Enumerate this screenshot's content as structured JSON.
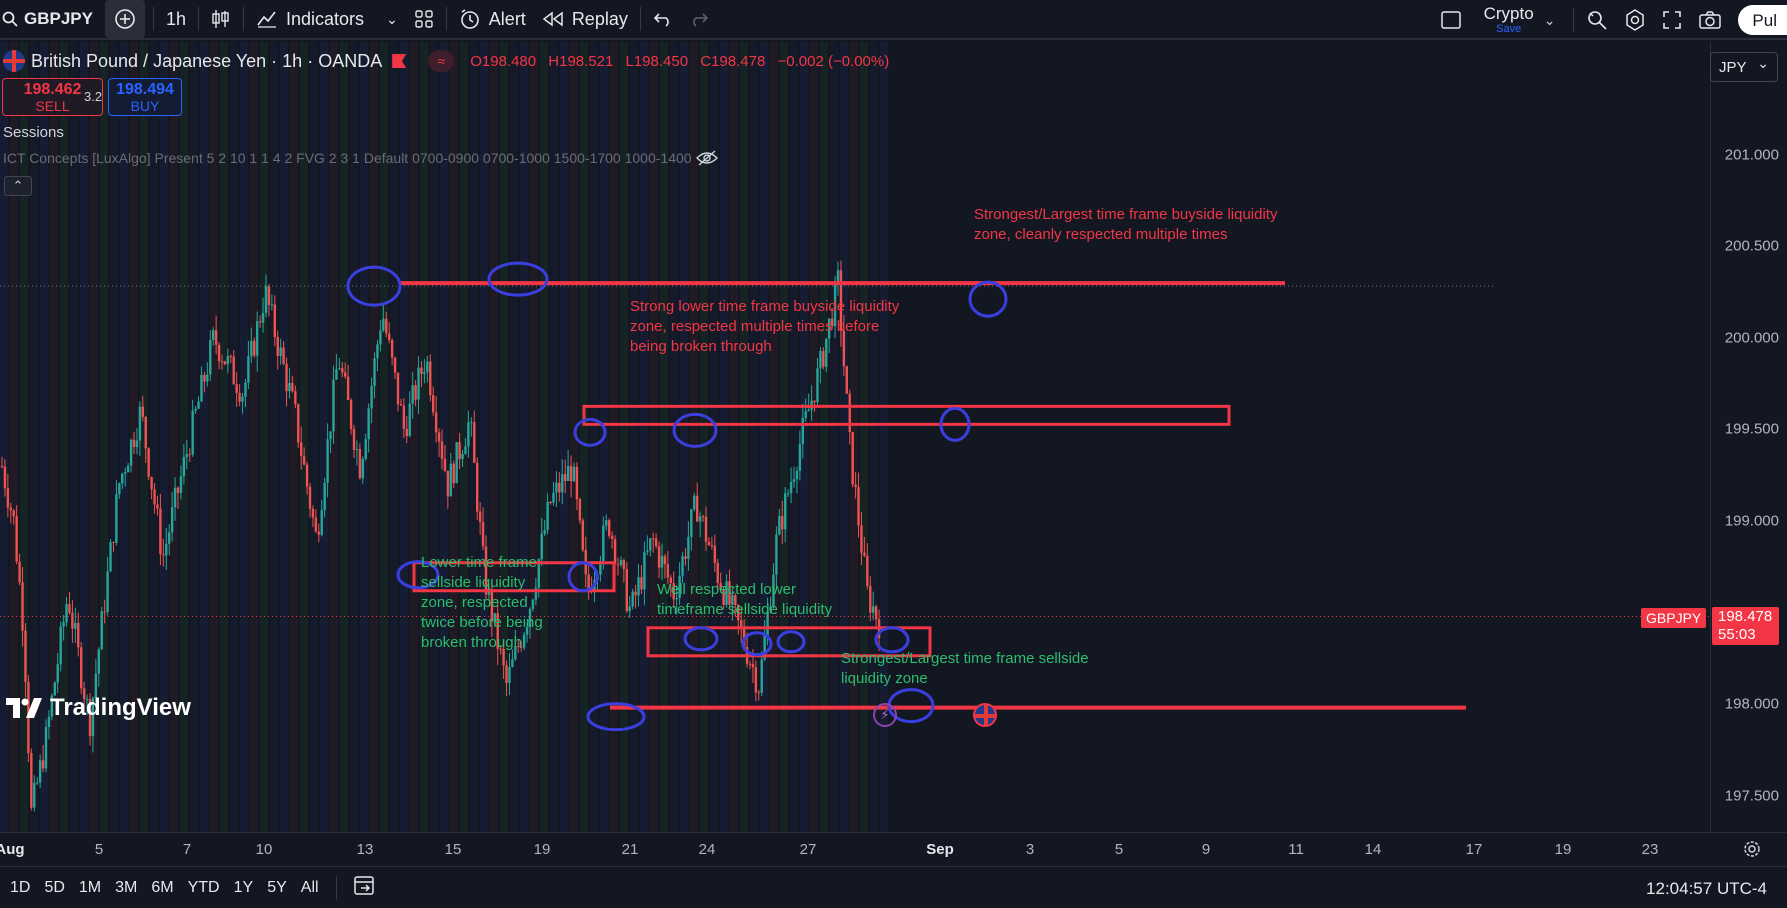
{
  "topbar": {
    "symbol": "GBPJPY",
    "interval": "1h",
    "indicators_label": "Indicators",
    "alert_label": "Alert",
    "replay_label": "Replay",
    "layout_name": "Crypto",
    "layout_save": "Save",
    "publish_label": "Pul"
  },
  "legend": {
    "title": "British Pound / Japanese Yen · 1h · OANDA",
    "open": "O198.480",
    "high": "H198.521",
    "low": "L198.450",
    "close": "C198.478",
    "change": "−0.002 (−0.00%)",
    "indicator_badge": "≈"
  },
  "trade": {
    "sell_price": "198.462",
    "sell_label": "SELL",
    "spread": "3.2",
    "buy_price": "198.494",
    "buy_label": "BUY"
  },
  "indicators": {
    "sessions": "Sessions",
    "ict": "ICT Concepts [LuxAlgo] Present 5 2 10 1 1 4 2 FVG 2 3 1 Default 0700-0900 0700-1000 1500-1700 1000-1400",
    "collapse": "⌃"
  },
  "price_scale": {
    "currency": "JPY",
    "ticks": [
      "201.000",
      "200.500",
      "200.000",
      "199.500",
      "199.000",
      "198.000",
      "197.500"
    ],
    "symbol_tag": "GBPJPY",
    "last_price": "198.478",
    "countdown": "55:03"
  },
  "time_axis": [
    {
      "label": "Aug",
      "bold": true
    },
    {
      "label": "5"
    },
    {
      "label": "7"
    },
    {
      "label": "10"
    },
    {
      "label": "13"
    },
    {
      "label": "15"
    },
    {
      "label": "19"
    },
    {
      "label": "21"
    },
    {
      "label": "24"
    },
    {
      "label": "27"
    },
    {
      "label": "Sep",
      "bold": true
    },
    {
      "label": "3"
    },
    {
      "label": "5"
    },
    {
      "label": "9"
    },
    {
      "label": "11"
    },
    {
      "label": "14"
    },
    {
      "label": "17"
    },
    {
      "label": "19"
    },
    {
      "label": "23"
    }
  ],
  "annotations": {
    "buyside_top": "Strongest/Largest time frame buyside liquidity\nzone, cleanly respected multiple times",
    "buyside_mid": "Strong lower time frame buyside liquidity\nzone, respected multiple times before\nbeing broken through",
    "sellside_left": "Lower time frame\nsellside liquidity\nzone, respected\ntwice before being\nbroken through",
    "sellside_mid": "Well respected lower\ntimeframe sellside liquidity",
    "sellside_bottom": "Strongest/Largest time frame sellside\nliquidity zone"
  },
  "branding": "TradingView",
  "bottombar": {
    "ranges": [
      "1D",
      "5D",
      "1M",
      "3M",
      "6M",
      "YTD",
      "1Y",
      "5Y",
      "All"
    ],
    "clock": "12:04:57 UTC-4"
  },
  "colors": {
    "background": "#131722",
    "bull": "#26a69a",
    "bear": "#ef5350",
    "annotation_red": "#f23645",
    "annotation_green": "#2bbd6e",
    "circle_blue": "#3b3fe0"
  },
  "chart_data": {
    "type": "candlestick",
    "symbol": "GBPJPY",
    "timeframe": "1h",
    "ylim": [
      197.3,
      201.3
    ],
    "last_price": 198.478,
    "levels": {
      "buyside_major": 200.3,
      "buyside_minor": 199.55,
      "sellside_minor_left": 198.75,
      "sellside_minor_mid": 198.4,
      "sellside_major": 197.98
    },
    "path": [
      [
        0,
        199.3
      ],
      [
        8,
        199.0
      ],
      [
        15,
        198.4
      ],
      [
        20,
        197.4
      ],
      [
        30,
        197.8
      ],
      [
        45,
        198.6
      ],
      [
        60,
        197.9
      ],
      [
        80,
        199.2
      ],
      [
        95,
        199.6
      ],
      [
        110,
        198.8
      ],
      [
        130,
        199.5
      ],
      [
        145,
        200.0
      ],
      [
        165,
        199.7
      ],
      [
        180,
        200.25
      ],
      [
        200,
        199.6
      ],
      [
        215,
        198.9
      ],
      [
        230,
        199.9
      ],
      [
        245,
        199.3
      ],
      [
        260,
        200.15
      ],
      [
        275,
        199.5
      ],
      [
        290,
        199.9
      ],
      [
        305,
        199.2
      ],
      [
        320,
        199.55
      ],
      [
        330,
        198.7
      ],
      [
        345,
        198.1
      ],
      [
        360,
        198.5
      ],
      [
        375,
        199.1
      ],
      [
        390,
        199.3
      ],
      [
        400,
        198.6
      ],
      [
        415,
        199.0
      ],
      [
        430,
        198.5
      ],
      [
        445,
        198.9
      ],
      [
        460,
        198.6
      ],
      [
        475,
        199.1
      ],
      [
        490,
        198.7
      ],
      [
        505,
        198.4
      ],
      [
        518,
        198.1
      ],
      [
        530,
        198.9
      ],
      [
        545,
        199.4
      ],
      [
        560,
        199.85
      ],
      [
        572,
        200.3
      ],
      [
        580,
        199.4
      ],
      [
        592,
        198.6
      ],
      [
        600,
        198.45
      ]
    ]
  }
}
